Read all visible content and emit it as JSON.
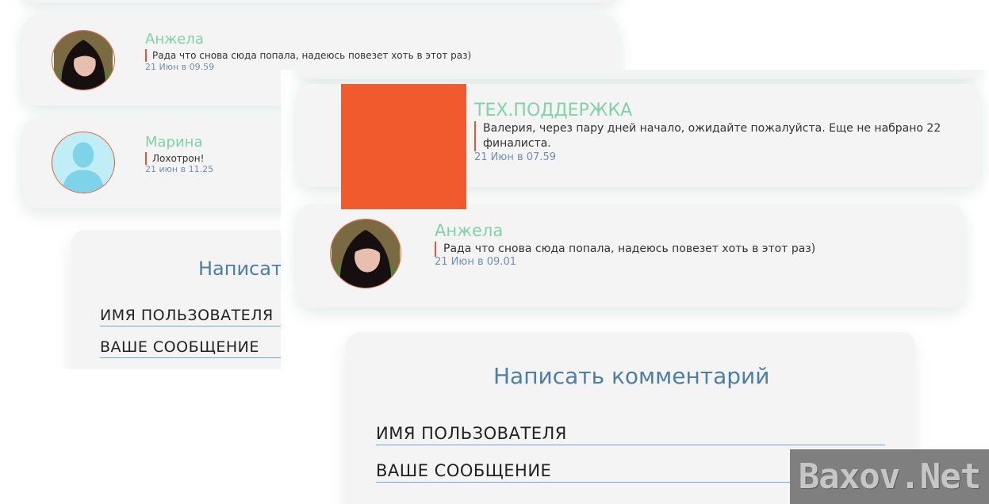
{
  "background_screenshot": {
    "comments": [
      {
        "name": "Анжела",
        "text": "Рада что снова сюда попала, надеюсь повезет хоть в этот раз)",
        "date": "21 Июн в 09.59",
        "avatar": "photo-avatar"
      },
      {
        "name": "Марина",
        "text": "Лохотрон!",
        "date": "21 июн в 11.25",
        "avatar": "default-user-icon"
      }
    ],
    "form": {
      "title": "Написать комментарий",
      "name_field": "ИМЯ ПОЛЬЗОВАТЕЛЯ",
      "message_field": "ВАШЕ СООБЩЕНИЕ"
    }
  },
  "foreground_screenshot": {
    "comments": [
      {
        "name": "ТЕХ.ПОДДЕРЖКА",
        "text": "Валерия, через пару дней начало, ожидайте пожалуйста. Еще не набрано 22 финалиста.",
        "date": "21 Июн в 07.59",
        "avatar": "orange-square"
      },
      {
        "name": "Анжела",
        "text": "Рада что снова сюда попала, надеюсь повезет хоть в этот раз)",
        "date": "21 Июн в 09.01",
        "avatar": "photo-avatar"
      }
    ],
    "form": {
      "title": "Написать комментарий",
      "name_field": "ИМЯ ПОЛЬЗОВАТЕЛЯ",
      "message_field": "ВАШЕ СООБЩЕНИЕ"
    }
  },
  "watermark": "Baxov.Net",
  "colors": {
    "name": "#7fd3a7",
    "date": "#6d8fb5",
    "accent": "#e5553a",
    "square": "#f05a2d",
    "title": "#4d7ea5"
  }
}
